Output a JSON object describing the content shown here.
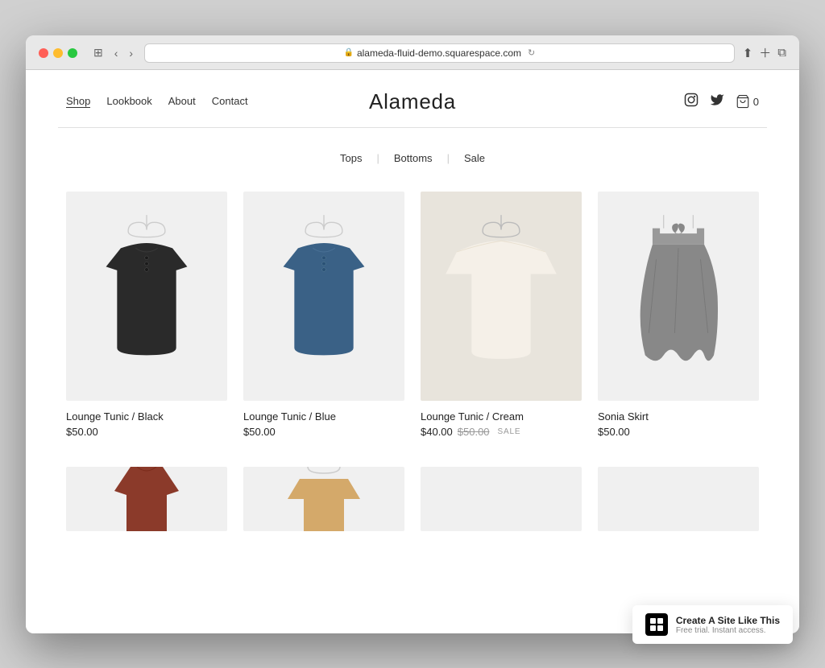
{
  "browser": {
    "url": "alameda-fluid-demo.squarespace.com",
    "back_label": "‹",
    "forward_label": "›"
  },
  "header": {
    "nav_items": [
      {
        "label": "Shop",
        "active": true
      },
      {
        "label": "Lookbook",
        "active": false
      },
      {
        "label": "About",
        "active": false
      },
      {
        "label": "Contact",
        "active": false
      }
    ],
    "site_title": "Alameda",
    "cart_label": "0",
    "instagram_icon": "instagram",
    "twitter_icon": "twitter"
  },
  "categories": [
    {
      "label": "Tops"
    },
    {
      "label": "Bottoms"
    },
    {
      "label": "Sale"
    }
  ],
  "products": [
    {
      "name": "Lounge Tunic / Black",
      "price": "$50.00",
      "sale_price": null,
      "original_price": null,
      "on_sale": false,
      "color": "black"
    },
    {
      "name": "Lounge Tunic / Blue",
      "price": "$50.00",
      "sale_price": null,
      "original_price": null,
      "on_sale": false,
      "color": "blue"
    },
    {
      "name": "Lounge Tunic / Cream",
      "price": "$40.00",
      "sale_price": "$40.00",
      "original_price": "$50.00",
      "on_sale": true,
      "color": "cream"
    },
    {
      "name": "Sonia Skirt",
      "price": "$50.00",
      "sale_price": null,
      "original_price": null,
      "on_sale": false,
      "color": "gray"
    }
  ],
  "squarespace_banner": {
    "title": "Create A Site Like This",
    "subtitle": "Free trial. Instant access."
  }
}
